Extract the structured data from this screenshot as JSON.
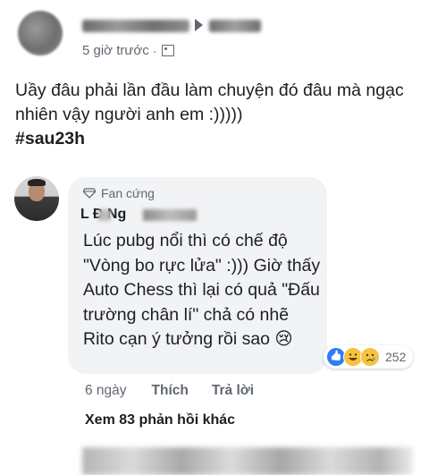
{
  "post": {
    "time": "5 giờ trước",
    "separator": "·",
    "audience_icon": "group-icon",
    "text": "Uầy đâu phải lần đầu làm chuyện đó đâu mà ngạc nhiên vậy người anh em :)))))",
    "hashtag": "#sau23h"
  },
  "comment": {
    "badge_icon": "diamond-icon",
    "badge": "Fan cứng",
    "author_visible": "L  Đ  Ng",
    "text": "Lúc pubg nổi thì có chế độ \"Vòng bo rực lửa\" :))) Giờ thấy Auto Chess thì lại có quả \"Đấu trường chân lí\" chả có nhẽ Rito cạn ý tưởng rồi sao 😢",
    "reaction_count": "252",
    "reactions": [
      "like",
      "haha",
      "sad"
    ],
    "time": "6 ngày",
    "like_label": "Thích",
    "reply_label": "Trả lời"
  },
  "more_replies": "Xem 83 phản hồi khác",
  "colors": {
    "text": "#1c1e21",
    "muted": "#606770",
    "bubble": "#f2f3f5",
    "like_blue": "#2e7cf6",
    "emoji_yellow": "#f7c23d"
  }
}
